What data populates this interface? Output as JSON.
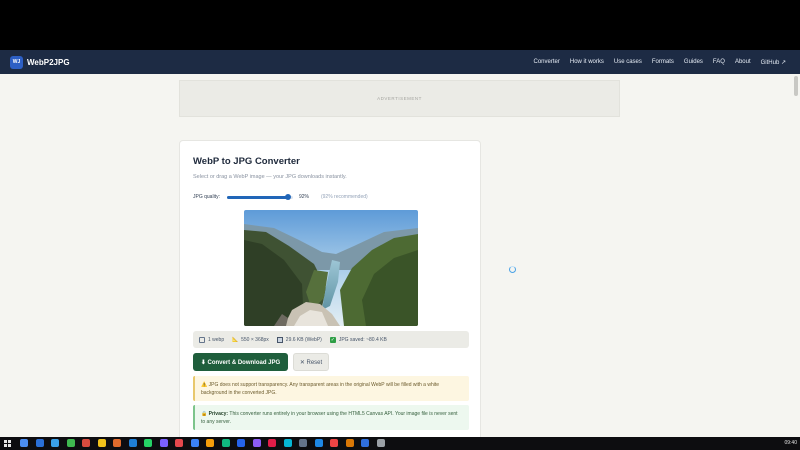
{
  "app": {
    "brand_logo": "WJ",
    "brand_name": "WebP2JPG"
  },
  "nav": {
    "links": [
      "Converter",
      "How it works",
      "Use cases",
      "Formats",
      "Guides",
      "FAQ",
      "About",
      "GitHub ↗"
    ]
  },
  "ad": {
    "label": "ADVERTISEMENT"
  },
  "converter": {
    "title": "WebP to JPG Converter",
    "subtitle": "Select or drag a WebP image — your JPG downloads instantly.",
    "quality": {
      "label": "JPG quality:",
      "value": "92%",
      "level": 0.92,
      "note": "(92% recommended)"
    },
    "info": {
      "count": "1 webp",
      "dimensions": "550 × 368px",
      "size": "29.6 KB (WebP)",
      "saved": "JPG saved: ~80.4 KB"
    },
    "buttons": {
      "convert": "⬇ Convert & Download JPG",
      "reset": "✕ Reset"
    },
    "warning": "⚠️ JPG does not support transparency. Any transparent areas in the original WebP will be filled with a white background in the converted JPG.",
    "privacy": {
      "icon": "🔒",
      "title": "Privacy:",
      "text": "This converter runs entirely in your browser using the HTML5 Canvas API. Your image file is never sent to any server."
    }
  },
  "taskbar": {
    "clock": "09:40",
    "icon_colors": [
      "#4b8df0",
      "#2a6fd6",
      "#3aa0e8",
      "#3fb950",
      "#d94b3e",
      "#f1c21b",
      "#e06b2c",
      "#1f7fd6",
      "#25d366",
      "#7b61ff",
      "#e5484d",
      "#3b82f6",
      "#f59e0b",
      "#10b981",
      "#2563eb",
      "#8b5cf6",
      "#e11d48",
      "#06b6d4",
      "#64748b",
      "#1e88e5",
      "#ef4444",
      "#d97706",
      "#2f6fde",
      "#9aa0a6"
    ]
  },
  "colors": {
    "nav_bg": "#1d2b44",
    "accent": "#2166b8",
    "primary_button": "#1f5e3c"
  }
}
